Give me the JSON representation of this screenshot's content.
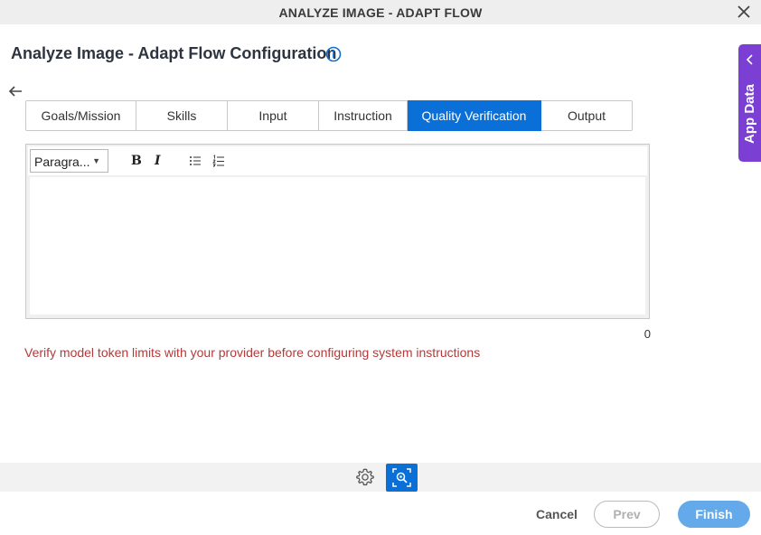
{
  "window": {
    "title": "ANALYZE IMAGE - ADAPT FLOW"
  },
  "header": {
    "title": "Analyze Image - Adapt Flow Configuration"
  },
  "tabs": [
    {
      "label": "Goals/Mission",
      "active": false
    },
    {
      "label": "Skills",
      "active": false
    },
    {
      "label": "Input",
      "active": false
    },
    {
      "label": "Instruction",
      "active": false
    },
    {
      "label": "Quality Verification",
      "active": true
    },
    {
      "label": "Output",
      "active": false
    }
  ],
  "editor": {
    "paragraph_select": "Paragra...",
    "bold_label": "B",
    "italic_label": "I",
    "content": "",
    "char_count": "0"
  },
  "warning": "Verify model token limits with your provider before configuring system instructions",
  "side_panel": {
    "label": "App Data"
  },
  "footer": {
    "cancel": "Cancel",
    "prev": "Prev",
    "finish": "Finish"
  },
  "colors": {
    "accent": "#0a6fd6",
    "app_data": "#7b3fd4",
    "warning": "#b23a3a",
    "finish": "#64a9ea"
  }
}
